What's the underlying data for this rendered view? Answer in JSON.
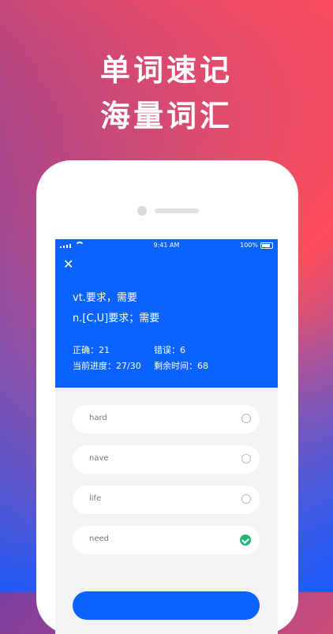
{
  "headline": {
    "line1": "单词速记",
    "line2": "海量词汇"
  },
  "status_bar": {
    "time": "9:41 AM",
    "battery": "100%"
  },
  "definition": {
    "line1": "vt.要求，需要",
    "line2": "n.[C,U]要求；需要"
  },
  "stats": {
    "correct": "正确：21",
    "wrong": "错误：6",
    "progress": "当前进度：27/30",
    "time_left": "剩余时间：68"
  },
  "options": [
    {
      "label": "hard",
      "selected": false
    },
    {
      "label": "nave",
      "selected": false
    },
    {
      "label": "life",
      "selected": false
    },
    {
      "label": "need",
      "selected": true
    }
  ],
  "colors": {
    "primary": "#0a63ff",
    "check": "#22b573"
  }
}
